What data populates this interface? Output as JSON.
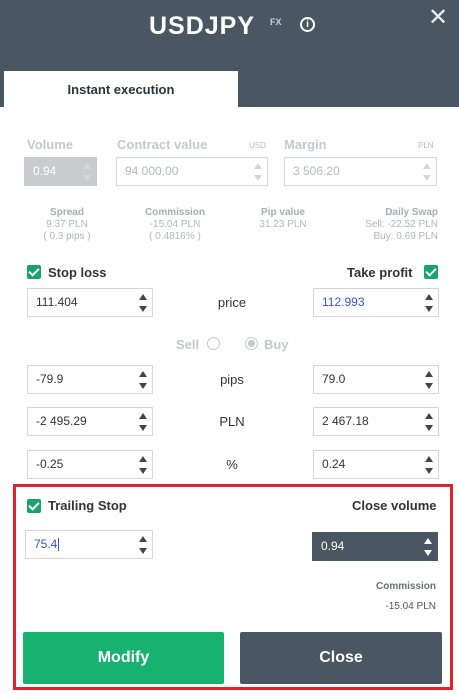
{
  "header": {
    "symbol": "USDJPY",
    "market_tag": "FX",
    "info_glyph": "i",
    "close_glyph": "✕"
  },
  "tab": {
    "label": "Instant execution"
  },
  "inputs": {
    "volume_label": "Volume",
    "volume_value": "0.94",
    "contract_label": "Contract value",
    "contract_unit": "USD",
    "contract_value": "94 000.00",
    "margin_label": "Margin",
    "margin_unit": "PLN",
    "margin_value": "3 506.20"
  },
  "stats": {
    "spread": {
      "title": "Spread",
      "line1": "9.37 PLN",
      "line2": "( 0.3 pips )"
    },
    "commission": {
      "title": "Commission",
      "line1": "-15.04 PLN",
      "line2": "( 0.4816% )"
    },
    "pip_value": {
      "title": "Pip value",
      "line1": "31.23 PLN"
    },
    "swap": {
      "title": "Daily Swap",
      "line1": "Sell: -22.52 PLN",
      "line2": "Buy: 0.69 PLN"
    }
  },
  "sl_tp": {
    "stop_loss_label": "Stop loss",
    "take_profit_label": "Take profit",
    "price_label": "price",
    "sl_price": "111.404",
    "tp_price": "112.993",
    "sell_label": "Sell",
    "buy_label": "Buy",
    "pips_label": "pips",
    "sl_pips": "-79.9",
    "tp_pips": "79.0",
    "pln_label": "PLN",
    "sl_pln": "-2 495.29",
    "tp_pln": "2 467.18",
    "pct_label": "%",
    "sl_pct": "-0.25",
    "tp_pct": "0.24"
  },
  "trailing": {
    "label": "Trailing Stop",
    "value": "75.4",
    "close_volume_label": "Close volume",
    "close_volume_value": "0.94",
    "commission_label": "Commission",
    "commission_value": "-15.04 PLN"
  },
  "actions": {
    "modify_label": "Modify",
    "close_label": "Close"
  },
  "colors": {
    "header": "#4a5661",
    "accent_green": "#17b26f",
    "highlight_red": "#e2222a",
    "tp_text": "#3752d6"
  }
}
